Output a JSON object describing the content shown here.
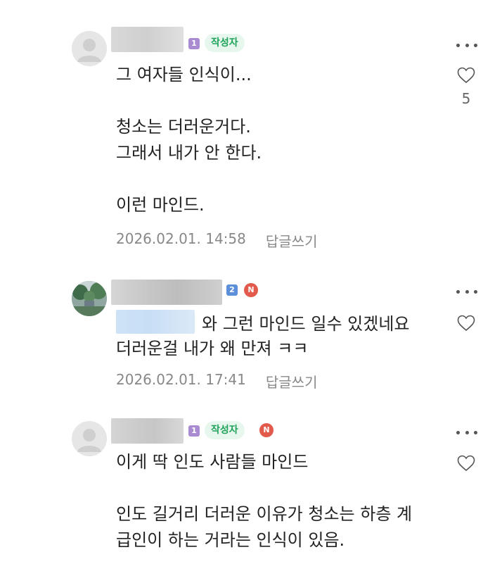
{
  "comments": [
    {
      "level": "1",
      "writer_tag": "작성자",
      "new_badge": "",
      "lines": [
        "그 여자들 인식이...",
        "",
        "청소는 더러운거다.",
        "그래서 내가 안 한다.",
        "",
        "이런 마인드."
      ],
      "date": "2026.02.01. 14:58",
      "reply_label": "답글쓰기",
      "likes": "5"
    },
    {
      "level": "2",
      "new_badge": "N",
      "line1_after_mention": "와 그런 마인드 일수 있겠네요",
      "line2": "더러운걸 내가 왜 만져 ㅋㅋ",
      "date": "2026.02.01. 17:41",
      "reply_label": "답글쓰기"
    },
    {
      "level": "1",
      "writer_tag": "작성자",
      "new_badge": "N",
      "lines": [
        "이게 딱 인도 사람들 마인드",
        "",
        "인도 길거리 더러운 이유가 청소는 하층 계",
        "급인이 하는 거라는 인식이 있음."
      ]
    }
  ],
  "colors": {
    "level1_badge": "#a88bd0",
    "level2_badge": "#5b8fd9",
    "writer_tag_text": "#1fa35b",
    "writer_tag_bg": "#e8f7ee",
    "new_badge": "#e25a4c",
    "meta_text": "#888888"
  },
  "icons": [
    "default-avatar-icon",
    "landscape-avatar-icon",
    "more-options-icon",
    "heart-icon"
  ]
}
